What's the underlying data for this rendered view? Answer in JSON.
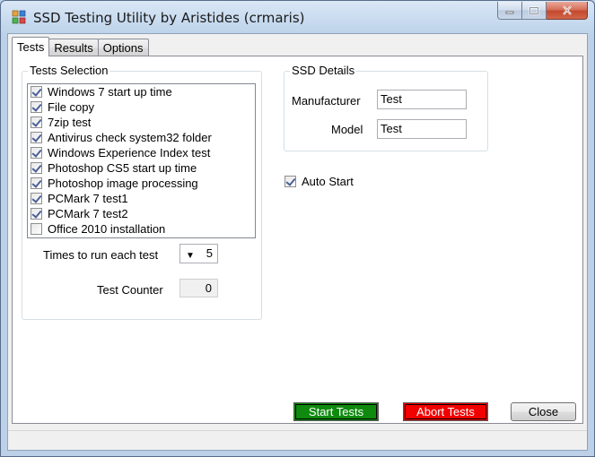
{
  "window": {
    "title": "SSD Testing Utility by Aristides (crmaris)"
  },
  "tabs": [
    {
      "label": "Tests"
    },
    {
      "label": "Results"
    },
    {
      "label": "Options"
    }
  ],
  "tests_selection": {
    "legend": "Tests Selection",
    "items": [
      {
        "label": "Windows 7 start up time",
        "checked": true
      },
      {
        "label": "File copy",
        "checked": true
      },
      {
        "label": "7zip test",
        "checked": true
      },
      {
        "label": "Antivirus check system32 folder",
        "checked": true
      },
      {
        "label": "Windows Experience Index test",
        "checked": true
      },
      {
        "label": "Photoshop CS5 start up time",
        "checked": true
      },
      {
        "label": "Photoshop image processing",
        "checked": true
      },
      {
        "label": "PCMark 7 test1",
        "checked": true
      },
      {
        "label": "PCMark 7 test2",
        "checked": true
      },
      {
        "label": "Office 2010 installation",
        "checked": false
      }
    ],
    "times_label": "Times to run each test",
    "times_value": "5",
    "counter_label": "Test Counter",
    "counter_value": "0"
  },
  "ssd_details": {
    "legend": "SSD Details",
    "manufacturer_label": "Manufacturer",
    "manufacturer_value": "Test",
    "model_label": "Model",
    "model_value": "Test"
  },
  "auto_start": {
    "label": "Auto Start",
    "checked": true
  },
  "buttons": {
    "start": "Start Tests",
    "abort": "Abort Tests",
    "close": "Close"
  },
  "colors": {
    "start_button": "#0f8a0f",
    "abort_button": "#f20000"
  }
}
